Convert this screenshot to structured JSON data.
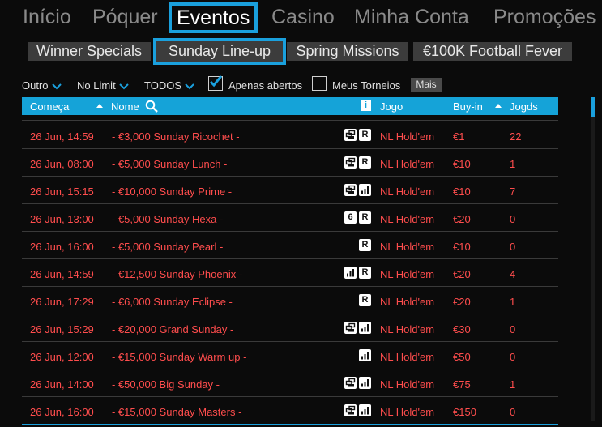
{
  "nav": {
    "items": [
      {
        "label": "Início"
      },
      {
        "label": "Póquer"
      },
      {
        "label": "Eventos"
      },
      {
        "label": "Casino"
      },
      {
        "label": "Minha Conta"
      },
      {
        "label": "Promoções"
      }
    ],
    "active": "Eventos"
  },
  "subtabs": [
    {
      "label": "Winner Specials"
    },
    {
      "label": "Sunday Line-up"
    },
    {
      "label": "Spring Missions"
    },
    {
      "label": "€100K Football Fever"
    }
  ],
  "filters": {
    "game_type": "Outro",
    "limit": "No Limit",
    "speed": "TODOS",
    "open_only_label": "Apenas abertos",
    "open_only_checked": true,
    "my_tournaments_label": "Meus Torneios",
    "my_tournaments_checked": false,
    "more_label": "Mais"
  },
  "table": {
    "headers": {
      "start": "Começa",
      "name": "Nome",
      "info": "i",
      "game": "Jogo",
      "buyin": "Buy-in",
      "players": "Jogds"
    },
    "rows": [
      {
        "start": "26 Jun, 14:59",
        "name": "- €3,000 Sunday Ricochet -",
        "icons": [
          "rebuy-icon",
          "R"
        ],
        "game": "NL Hold'em",
        "buyin": "€1",
        "players": "22"
      },
      {
        "start": "26 Jun, 08:00",
        "name": "- €5,000 Sunday Lunch -",
        "icons": [
          "rebuy-icon",
          "R"
        ],
        "game": "NL Hold'em",
        "buyin": "€10",
        "players": "1"
      },
      {
        "start": "26 Jun, 15:15",
        "name": "- €10,000 Sunday Prime -",
        "icons": [
          "rebuy-icon",
          "bars-icon"
        ],
        "game": "NL Hold'em",
        "buyin": "€10",
        "players": "7"
      },
      {
        "start": "26 Jun, 13:00",
        "name": "- €5,000 Sunday Hexa -",
        "icons": [
          "6",
          "R"
        ],
        "game": "NL Hold'em",
        "buyin": "€20",
        "players": "0"
      },
      {
        "start": "26 Jun, 16:00",
        "name": "- €5,000 Sunday Pearl -",
        "icons": [
          "R"
        ],
        "game": "NL Hold'em",
        "buyin": "€10",
        "players": "0"
      },
      {
        "start": "26 Jun, 14:59",
        "name": "- €12,500 Sunday Phoenix -",
        "icons": [
          "bars-icon",
          "R"
        ],
        "game": "NL Hold'em",
        "buyin": "€20",
        "players": "4"
      },
      {
        "start": "26 Jun, 17:29",
        "name": "- €6,000 Sunday Eclipse -",
        "icons": [
          "R"
        ],
        "game": "NL Hold'em",
        "buyin": "€20",
        "players": "1"
      },
      {
        "start": "26 Jun, 15:29",
        "name": "- €20,000 Grand Sunday -",
        "icons": [
          "rebuy-icon",
          "bars-icon"
        ],
        "game": "NL Hold'em",
        "buyin": "€30",
        "players": "0"
      },
      {
        "start": "26 Jun, 12:00",
        "name": "- €15,000 Sunday Warm up -",
        "icons": [
          "bars-icon"
        ],
        "game": "NL Hold'em",
        "buyin": "€50",
        "players": "0"
      },
      {
        "start": "26 Jun, 14:00",
        "name": "- €50,000 Big Sunday -",
        "icons": [
          "rebuy-icon",
          "bars-icon"
        ],
        "game": "NL Hold'em",
        "buyin": "€75",
        "players": "1"
      },
      {
        "start": "26 Jun, 16:00",
        "name": "- €15,000 Sunday Masters -",
        "icons": [
          "rebuy-icon",
          "bars-icon"
        ],
        "game": "NL Hold'em",
        "buyin": "€150",
        "players": "0"
      }
    ]
  },
  "colors": {
    "accent": "#1aa0dd",
    "row_text": "#ff4d4d",
    "header_bg": "#15a3d8",
    "background": "#0b0b0b"
  }
}
